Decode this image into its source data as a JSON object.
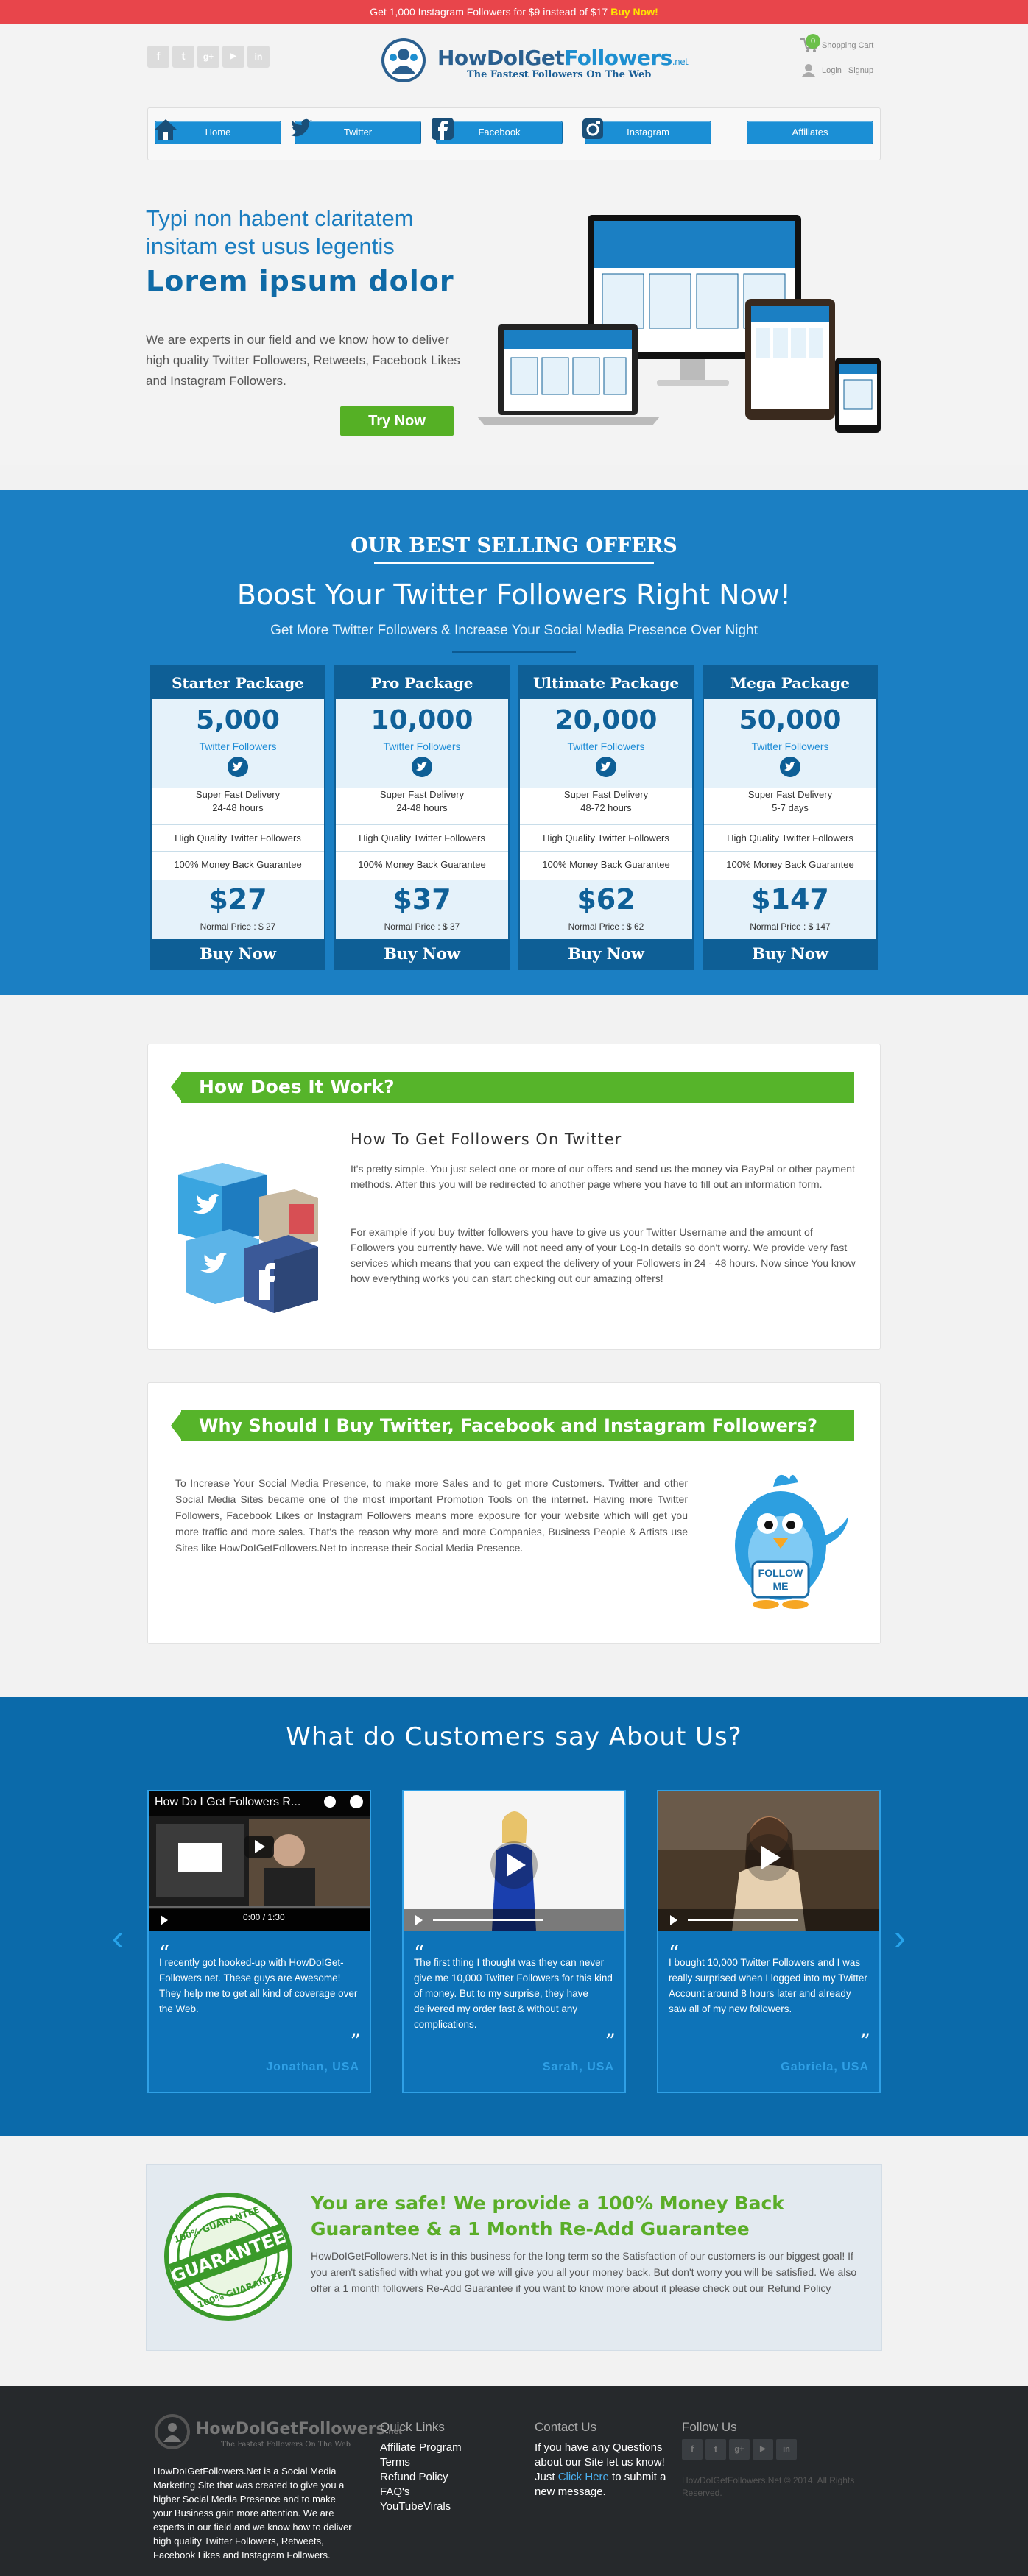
{
  "promo": {
    "text": "Get 1,000 Instagram Followers for $9 instead of $17",
    "cta": "Buy Now!"
  },
  "header": {
    "logo_prefix": "HowDoIGet",
    "logo_bold": "Followers",
    "logo_suffix": ".net",
    "tagline": "The Fastest Followers On The Web",
    "cart_label": "Shopping Cart",
    "cart_count": "0",
    "login_label": "Login | Signup",
    "social_icons": [
      "facebook-icon",
      "twitter-icon",
      "google-plus-icon",
      "youtube-icon",
      "linkedin-icon"
    ]
  },
  "nav": [
    {
      "label": "Home",
      "icon": "home-icon"
    },
    {
      "label": "Twitter",
      "icon": "twitter-icon"
    },
    {
      "label": "Facebook",
      "icon": "facebook-icon"
    },
    {
      "label": "Instagram",
      "icon": "instagram-icon"
    },
    {
      "label": "Affiliates",
      "icon": ""
    }
  ],
  "hero": {
    "line1": "Typi non habent claritatem",
    "line2": "insitam est usus legentis",
    "line3": "Lorem ipsum dolor",
    "paragraph": "We are experts in our field and we know how to deliver high quality Twitter Followers, Retweets, Facebook Likes and Instagram Followers.",
    "button": "Try Now"
  },
  "offers": {
    "title": "OUR BEST SELLING OFFERS",
    "headline": "Boost Your Twitter Followers Right Now!",
    "subline": "Get More Twitter Followers & Increase Your Social Media Presence Over Night",
    "packages": [
      {
        "name": "Starter Package",
        "amount": "5,000",
        "unit": "Twitter Followers",
        "delivery": "Super Fast Delivery",
        "time": "24-48 hours",
        "quality": "High Quality Twitter Followers",
        "guarantee": "100% Money Back Guarantee",
        "price": "$27",
        "normal": "Normal Price : $ 27",
        "buy": "Buy Now"
      },
      {
        "name": "Pro Package",
        "amount": "10,000",
        "unit": "Twitter Followers",
        "delivery": "Super Fast Delivery",
        "time": "24-48 hours",
        "quality": "High Quality Twitter Followers",
        "guarantee": "100% Money Back Guarantee",
        "price": "$37",
        "normal": "Normal Price : $ 37",
        "buy": "Buy Now"
      },
      {
        "name": "Ultimate Package",
        "amount": "20,000",
        "unit": "Twitter Followers",
        "delivery": "Super Fast Delivery",
        "time": "48-72 hours",
        "quality": "High Quality Twitter Followers",
        "guarantee": "100% Money Back Guarantee",
        "price": "$62",
        "normal": "Normal Price : $ 62",
        "buy": "Buy Now"
      },
      {
        "name": "Mega Package",
        "amount": "50,000",
        "unit": "Twitter Followers",
        "delivery": "Super Fast Delivery",
        "time": "5-7 days",
        "quality": "High Quality Twitter Followers",
        "guarantee": "100% Money Back Guarantee",
        "price": "$147",
        "normal": "Normal Price : $ 147",
        "buy": "Buy Now"
      }
    ]
  },
  "how": {
    "ribbon": "How Does It Work?",
    "heading": "How To Get Followers On Twitter",
    "p1": "It's pretty simple. You just select one or more of our offers and send us the money via PayPal or other payment methods. After this you will be redirected to another page where you have to fill out an information form.",
    "p2": "For example if you buy twitter followers you have to give us your Twitter Username and the amount of Followers you currently have. We will not need any of your Log-In details so don't worry.  We provide very fast services which means that you can expect the delivery of your Followers in 24 - 48 hours. Now since You know how everything works you can start checking out our amazing offers!"
  },
  "why": {
    "ribbon": "Why Should I Buy Twitter, Facebook and Instagram Followers?",
    "paragraph": "To Increase Your Social Media Presence, to make more Sales and to get more Customers. Twitter and other Social Media Sites became one of the most important Promotion Tools on the internet. Having more Twitter Followers, Facebook Likes or Instagram Followers means more exposure for your website which will get you more traffic and more sales. That's the reason why more and more Companies, Business People & Artists use Sites like HowDoIGetFollowers.Net to increase their Social Media Presence.",
    "bird_sign": "FOLLOW ME"
  },
  "testimonials": {
    "heading": "What do Customers say About Us?",
    "items": [
      {
        "video_title": "How Do I Get Followers R...",
        "video_time": "0:00 / 1:30",
        "quote": "I recently got hooked-up with HowDoIGet-Followers.net. These guys are Awesome! They help me to get all kind of coverage over the Web.",
        "name": "Jonathan, USA"
      },
      {
        "video_title": "",
        "video_time": "",
        "quote": "The first thing I thought was they can never give me 10,000 Twitter Followers for this kind of money. But to my surprise, they have delivered my order fast & without any complications.",
        "name": "Sarah, USA"
      },
      {
        "video_title": "",
        "video_time": "",
        "quote": "I bought 10,000 Twitter Followers and I was really surprised when I logged into my Twitter Account around 8 hours later and already saw all of my new followers.",
        "name": "Gabriela, USA"
      }
    ]
  },
  "guarantee": {
    "seal_top": "100% GUARANTEE",
    "seal_mid": "GUARANTEE",
    "seal_bottom": "100% GUARANTEE",
    "heading": "You are safe! We provide a 100% Money Back Guarantee & a 1 Month Re-Add Guarantee",
    "paragraph": "HowDoIGetFollowers.Net is in this business for the long term so the Satisfaction of our customers is our biggest goal! If you aren't satisfied with what you got we will give you all your money back. But don't worry you will be satisfied. We also offer a 1 month followers Re-Add Guarantee if you want to know more about it please check out our Refund Policy"
  },
  "footer": {
    "logo_prefix": "HowDoIGet",
    "logo_bold": "Followers",
    "logo_suffix": ".net",
    "tagline": "The Fastest Followers On The Web",
    "about": "HowDoIGetFollowers.Net is a Social Media Marketing Site that was created to give you a higher Social Media Presence and to make your Business gain more attention. We are experts in our field and we know how to deliver high quality Twitter Followers, Retweets, Facebook Likes and Instagram Followers.",
    "quick_links_title": "Quick Links",
    "quick_links": [
      "Affiliate Program",
      "Terms",
      "Refund Policy",
      "FAQ's",
      "YouTubeVirals"
    ],
    "contact_title": "Contact Us",
    "contact_text": "If you have any Questions about our Site let us know! Just",
    "contact_link": "Click Here",
    "contact_after": "to submit a new message.",
    "follow_title": "Follow Us",
    "copyright": "HowDoIGetFollowers.Net © 2014. All Rights Reserved."
  },
  "colors": {
    "primary_blue": "#1b7fc3",
    "dark_blue": "#0e5f96",
    "green": "#56b42a",
    "promo_red": "#e8454b"
  }
}
